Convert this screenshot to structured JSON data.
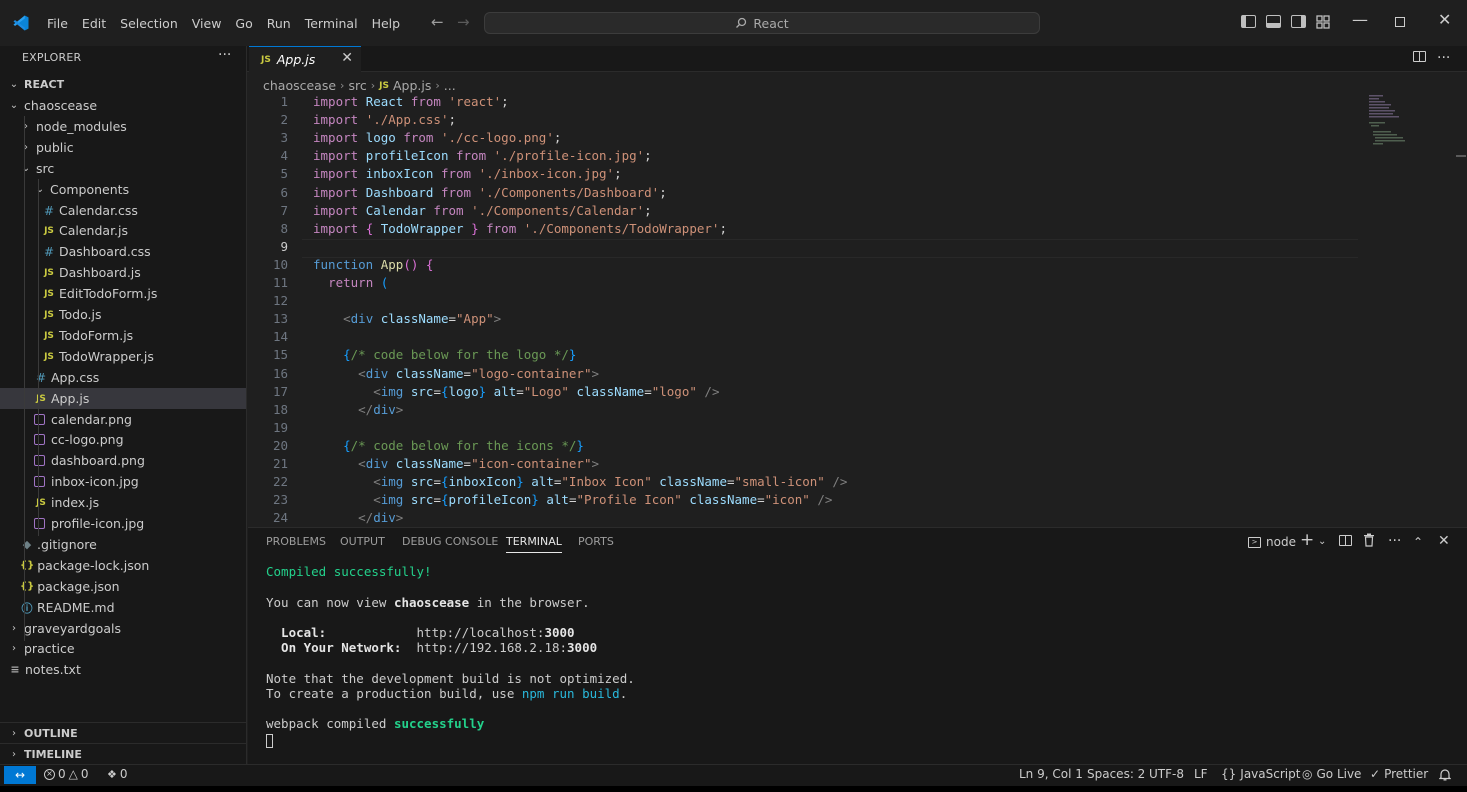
{
  "title_bar": {
    "menu": [
      "File",
      "Edit",
      "Selection",
      "View",
      "Go",
      "Run",
      "Terminal",
      "Help"
    ],
    "search_text": "React"
  },
  "sidebar": {
    "header": "EXPLORER",
    "root": "REACT",
    "tree": [
      {
        "label": "chaoscease",
        "kind": "folder-open",
        "depth": 1
      },
      {
        "label": "node_modules",
        "kind": "folder",
        "depth": 2
      },
      {
        "label": "public",
        "kind": "folder",
        "depth": 2
      },
      {
        "label": "src",
        "kind": "folder-open",
        "depth": 2
      },
      {
        "label": "Components",
        "kind": "folder-open",
        "depth": 3
      },
      {
        "label": "Calendar.css",
        "kind": "css",
        "depth": 4
      },
      {
        "label": "Calendar.js",
        "kind": "js",
        "depth": 4
      },
      {
        "label": "Dashboard.css",
        "kind": "css",
        "depth": 4
      },
      {
        "label": "Dashboard.js",
        "kind": "js",
        "depth": 4
      },
      {
        "label": "EditTodoForm.js",
        "kind": "js",
        "depth": 4
      },
      {
        "label": "Todo.js",
        "kind": "js",
        "depth": 4
      },
      {
        "label": "TodoForm.js",
        "kind": "js",
        "depth": 4
      },
      {
        "label": "TodoWrapper.js",
        "kind": "js",
        "depth": 4
      },
      {
        "label": "App.css",
        "kind": "css",
        "depth": 3
      },
      {
        "label": "App.js",
        "kind": "js",
        "depth": 3,
        "selected": true
      },
      {
        "label": "calendar.png",
        "kind": "img",
        "depth": 3
      },
      {
        "label": "cc-logo.png",
        "kind": "img",
        "depth": 3
      },
      {
        "label": "dashboard.png",
        "kind": "img",
        "depth": 3
      },
      {
        "label": "inbox-icon.jpg",
        "kind": "img",
        "depth": 3
      },
      {
        "label": "index.js",
        "kind": "js",
        "depth": 3
      },
      {
        "label": "profile-icon.jpg",
        "kind": "img",
        "depth": 3
      },
      {
        "label": ".gitignore",
        "kind": "git",
        "depth": 2
      },
      {
        "label": "package-lock.json",
        "kind": "json",
        "depth": 2
      },
      {
        "label": "package.json",
        "kind": "json",
        "depth": 2
      },
      {
        "label": "README.md",
        "kind": "info",
        "depth": 2
      },
      {
        "label": "graveyardgoals",
        "kind": "folder",
        "depth": 1
      },
      {
        "label": "practice",
        "kind": "folder",
        "depth": 1
      },
      {
        "label": "notes.txt",
        "kind": "txt",
        "depth": 1
      }
    ],
    "outline": "OUTLINE",
    "timeline": "TIMELINE"
  },
  "editor": {
    "tab_label": "App.js",
    "tab_badge": "JS",
    "breadcrumb": [
      "chaoscease",
      "src",
      "App.js",
      "..."
    ],
    "active_line": 9,
    "lines": [
      [
        [
          "kw",
          "import "
        ],
        [
          "id",
          "React "
        ],
        [
          "kw",
          "from "
        ],
        [
          "str",
          "'react'"
        ],
        [
          "pl",
          ";"
        ]
      ],
      [
        [
          "kw",
          "import "
        ],
        [
          "str",
          "'./App.css'"
        ],
        [
          "pl",
          ";"
        ]
      ],
      [
        [
          "kw",
          "import "
        ],
        [
          "id",
          "logo "
        ],
        [
          "kw",
          "from "
        ],
        [
          "str",
          "'./cc-logo.png'"
        ],
        [
          "pl",
          ";"
        ]
      ],
      [
        [
          "kw",
          "import "
        ],
        [
          "id",
          "profileIcon "
        ],
        [
          "kw",
          "from "
        ],
        [
          "str",
          "'./profile-icon.jpg'"
        ],
        [
          "pl",
          ";"
        ]
      ],
      [
        [
          "kw",
          "import "
        ],
        [
          "id",
          "inboxIcon "
        ],
        [
          "kw",
          "from "
        ],
        [
          "str",
          "'./inbox-icon.jpg'"
        ],
        [
          "pl",
          ";"
        ]
      ],
      [
        [
          "kw",
          "import "
        ],
        [
          "id",
          "Dashboard "
        ],
        [
          "kw",
          "from "
        ],
        [
          "str",
          "'./Components/Dashboard'"
        ],
        [
          "pl",
          ";"
        ]
      ],
      [
        [
          "kw",
          "import "
        ],
        [
          "id",
          "Calendar "
        ],
        [
          "kw",
          "from "
        ],
        [
          "str",
          "'./Components/Calendar'"
        ],
        [
          "pl",
          ";"
        ]
      ],
      [
        [
          "kw",
          "import "
        ],
        [
          "brace",
          "{ "
        ],
        [
          "id",
          "TodoWrapper "
        ],
        [
          "brace",
          "} "
        ],
        [
          "kw",
          "from "
        ],
        [
          "str",
          "'./Components/TodoWrapper'"
        ],
        [
          "pl",
          ";"
        ]
      ],
      [],
      [
        [
          "fn-kw",
          "function "
        ],
        [
          "fn",
          "App"
        ],
        [
          "brace",
          "() "
        ],
        [
          "brace",
          "{"
        ]
      ],
      [
        [
          "pl",
          "  "
        ],
        [
          "kw",
          "return "
        ],
        [
          "brace2",
          "("
        ]
      ],
      [],
      [
        [
          "pl",
          "    "
        ],
        [
          "tagc",
          "<"
        ],
        [
          "tag",
          "div "
        ],
        [
          "attr",
          "className"
        ],
        [
          "pl",
          "="
        ],
        [
          "str",
          "\"App\""
        ],
        [
          "tagc",
          ">"
        ]
      ],
      [],
      [
        [
          "pl",
          "    "
        ],
        [
          "brace2",
          "{"
        ],
        [
          "cm",
          "/* code below for the logo */"
        ],
        [
          "brace2",
          "}"
        ]
      ],
      [
        [
          "pl",
          "      "
        ],
        [
          "tagc",
          "<"
        ],
        [
          "tag",
          "div "
        ],
        [
          "attr",
          "className"
        ],
        [
          "pl",
          "="
        ],
        [
          "str",
          "\"logo-container\""
        ],
        [
          "tagc",
          ">"
        ]
      ],
      [
        [
          "pl",
          "        "
        ],
        [
          "tagc",
          "<"
        ],
        [
          "tag",
          "img "
        ],
        [
          "attr",
          "src"
        ],
        [
          "pl",
          "="
        ],
        [
          "brace2",
          "{"
        ],
        [
          "id",
          "logo"
        ],
        [
          "brace2",
          "} "
        ],
        [
          "attr",
          "alt"
        ],
        [
          "pl",
          "="
        ],
        [
          "str",
          "\"Logo\" "
        ],
        [
          "attr",
          "className"
        ],
        [
          "pl",
          "="
        ],
        [
          "str",
          "\"logo\" "
        ],
        [
          "tagc",
          "/>"
        ]
      ],
      [
        [
          "pl",
          "      "
        ],
        [
          "tagc",
          "</"
        ],
        [
          "tag",
          "div"
        ],
        [
          "tagc",
          ">"
        ]
      ],
      [],
      [
        [
          "pl",
          "    "
        ],
        [
          "brace2",
          "{"
        ],
        [
          "cm",
          "/* code below for the icons */"
        ],
        [
          "brace2",
          "}"
        ]
      ],
      [
        [
          "pl",
          "      "
        ],
        [
          "tagc",
          "<"
        ],
        [
          "tag",
          "div "
        ],
        [
          "attr",
          "className"
        ],
        [
          "pl",
          "="
        ],
        [
          "str",
          "\"icon-container\""
        ],
        [
          "tagc",
          ">"
        ]
      ],
      [
        [
          "pl",
          "        "
        ],
        [
          "tagc",
          "<"
        ],
        [
          "tag",
          "img "
        ],
        [
          "attr",
          "src"
        ],
        [
          "pl",
          "="
        ],
        [
          "brace2",
          "{"
        ],
        [
          "id",
          "inboxIcon"
        ],
        [
          "brace2",
          "} "
        ],
        [
          "attr",
          "alt"
        ],
        [
          "pl",
          "="
        ],
        [
          "str",
          "\"Inbox Icon\" "
        ],
        [
          "attr",
          "className"
        ],
        [
          "pl",
          "="
        ],
        [
          "str",
          "\"small-icon\" "
        ],
        [
          "tagc",
          "/>"
        ]
      ],
      [
        [
          "pl",
          "        "
        ],
        [
          "tagc",
          "<"
        ],
        [
          "tag",
          "img "
        ],
        [
          "attr",
          "src"
        ],
        [
          "pl",
          "="
        ],
        [
          "brace2",
          "{"
        ],
        [
          "id",
          "profileIcon"
        ],
        [
          "brace2",
          "} "
        ],
        [
          "attr",
          "alt"
        ],
        [
          "pl",
          "="
        ],
        [
          "str",
          "\"Profile Icon\" "
        ],
        [
          "attr",
          "className"
        ],
        [
          "pl",
          "="
        ],
        [
          "str",
          "\"icon\" "
        ],
        [
          "tagc",
          "/>"
        ]
      ],
      [
        [
          "pl",
          "      "
        ],
        [
          "tagc",
          "</"
        ],
        [
          "tag",
          "div"
        ],
        [
          "tagc",
          ">"
        ]
      ]
    ]
  },
  "panel": {
    "tabs": [
      "PROBLEMS",
      "OUTPUT",
      "DEBUG CONSOLE",
      "TERMINAL",
      "PORTS"
    ],
    "active_tab": "TERMINAL",
    "terminal_name": "node",
    "terminal": {
      "compiled": "Compiled successfully!",
      "view_prefix": "You can now view ",
      "app_name": "chaoscease",
      "view_suffix": " in the browser.",
      "local_label": "  Local:            ",
      "local_url_pre": "http://localhost:",
      "local_port": "3000",
      "network_label": "  On Your Network:  ",
      "network_url_pre": "http://192.168.2.18:",
      "network_port": "3000",
      "note": "Note that the development build is not optimized.",
      "prod_prefix": "To create a production build, use ",
      "prod_cmd": "npm run build",
      "prod_suffix": ".",
      "webpack_prefix": "webpack compiled ",
      "webpack_status": "successfully"
    }
  },
  "status_bar": {
    "errors": "0",
    "warnings": "0",
    "ports": "0",
    "position": "Ln 9, Col 1",
    "spaces": "Spaces: 2",
    "encoding": "UTF-8",
    "eol": "LF",
    "language": "JavaScript",
    "go_live": "Go Live",
    "prettier": "Prettier"
  },
  "colors": {
    "accent": "#0078d4",
    "bg": "#1f1f1f",
    "sidebar_bg": "#181818",
    "success_green": "#23d18b"
  }
}
